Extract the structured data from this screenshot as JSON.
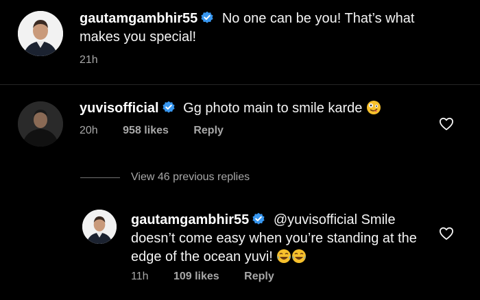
{
  "colors": {
    "background": "#000000",
    "text": "#f5f5f5",
    "muted": "#a8a8a8",
    "verified": "#3897f0"
  },
  "comments": [
    {
      "username": "gautamgambhir55",
      "verified": true,
      "text": "No one can be you! That’s what makes you special!",
      "time": "21h",
      "likes": "",
      "reply_label": ""
    },
    {
      "username": "yuvisofficial",
      "verified": true,
      "text": "Gg photo main to smile karde",
      "emoji": "zany-face-emoji",
      "time": "20h",
      "likes": "958 likes",
      "reply_label": "Reply",
      "like_icon": "heart-icon"
    }
  ],
  "view_replies_label": "View 46 previous replies",
  "reply": {
    "username": "gautamgambhir55",
    "verified": true,
    "mention": "@yuvisofficial",
    "text": "Smile doesn’t come easy when you’re standing at the edge of the ocean yuvi!",
    "emoji": "laughing-tears-emoji",
    "time": "11h",
    "likes": "109 likes",
    "reply_label": "Reply",
    "like_icon": "heart-icon"
  }
}
